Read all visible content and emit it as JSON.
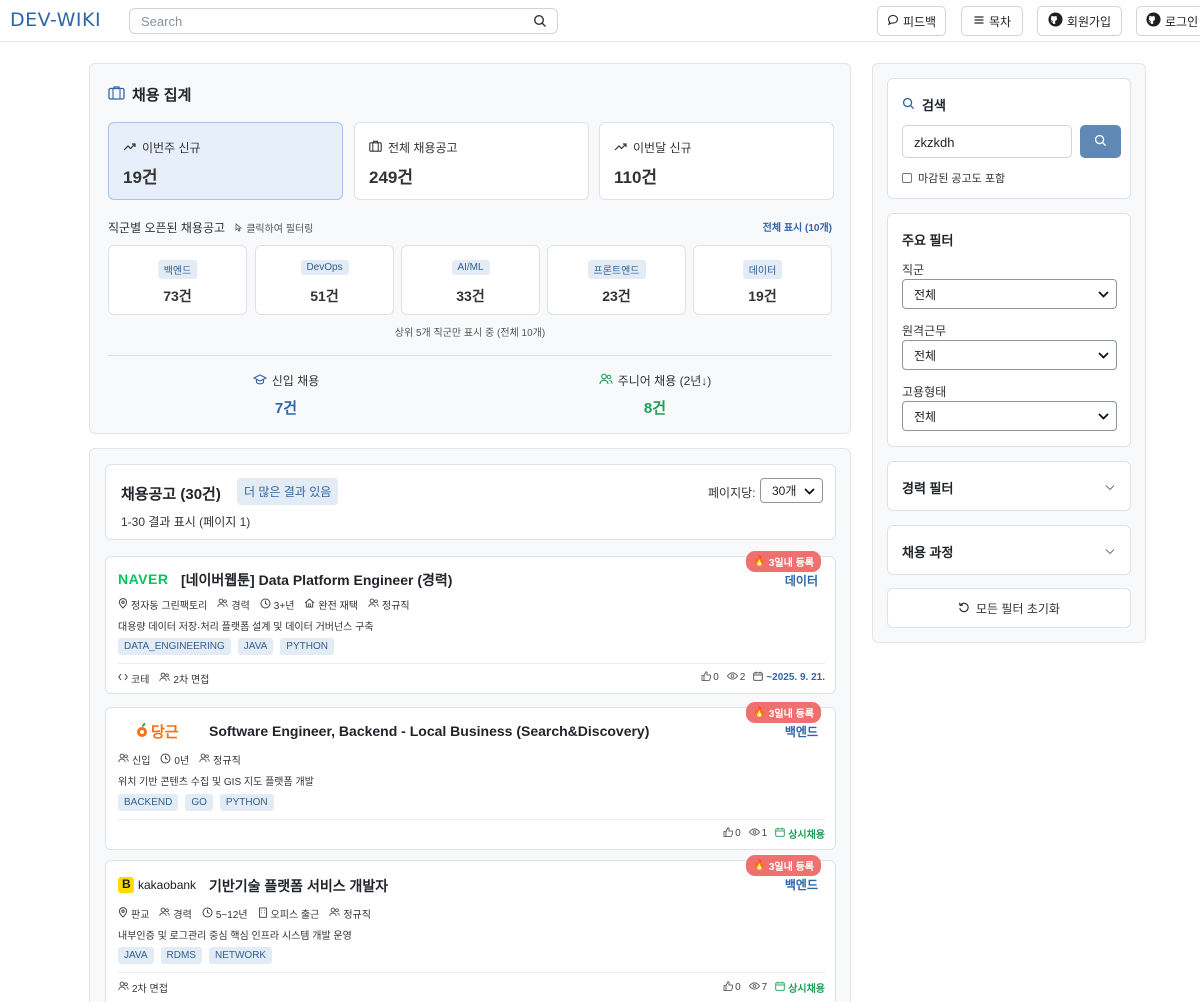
{
  "header": {
    "logo": "DEV-WIKI",
    "search_placeholder": "Search",
    "feedback": "피드백",
    "toc": "목차",
    "signup": "회원가입",
    "login": "로그인"
  },
  "summary": {
    "title": "채용 집계",
    "stats": [
      {
        "label": "이번주 신규",
        "value": "19건"
      },
      {
        "label": "전체 채용공고",
        "value": "249건"
      },
      {
        "label": "이번달 신규",
        "value": "110건"
      }
    ],
    "jobs_section_label": "직군별 오픈된 채용공고",
    "jobs_section_hint": "클릭하여 필터링",
    "show_all": "전체 표시 (10개)",
    "job_groups": [
      {
        "name": "백엔드",
        "count": "73건"
      },
      {
        "name": "DevOps",
        "count": "51건"
      },
      {
        "name": "AI/ML",
        "count": "33건"
      },
      {
        "name": "프론트엔드",
        "count": "23건"
      },
      {
        "name": "데이터",
        "count": "19건"
      }
    ],
    "top_note": "상위 5개 직군만 표시 중 (전체 10개)",
    "newbie": {
      "label": "신입 채용",
      "value": "7건"
    },
    "junior": {
      "label": "주니어 채용 (2년↓)",
      "value": "8건"
    }
  },
  "listing": {
    "title": "채용공고 (30건)",
    "more_badge": "더 많은 결과 있음",
    "per_page_label": "페이지당:",
    "per_page_value": "30개",
    "range_text": "1-30 결과 표시 (페이지 1)",
    "jobs": [
      {
        "company": "NAVER",
        "title": "[네이버웹툰] Data Platform Engineer (경력)",
        "hot": "3일내 등록",
        "category": "데이터",
        "meta": {
          "location": "정자동 그린팩토리",
          "level": "경력",
          "years": "3+년",
          "remote": "완전 재택",
          "employment": "정규직"
        },
        "desc": "대용량 데이터 저장·처리 플랫폼 설계 및 데이터 거버넌스 구축",
        "tags": [
          "DATA_ENGINEERING",
          "JAVA",
          "PYTHON"
        ],
        "footer": {
          "coding": "코테",
          "interview": "2차 면접"
        },
        "likes": "0",
        "views": "2",
        "deadline": "~2025. 9. 21."
      },
      {
        "company": "당근",
        "title": "Software Engineer, Backend - Local Business (Search&Discovery)",
        "hot": "3일내 등록",
        "category": "백엔드",
        "meta": {
          "level": "신입",
          "years": "0년",
          "employment": "정규직"
        },
        "desc": "위치 기반 콘텐츠 수집 및 GIS 지도 플랫폼 개발",
        "tags": [
          "BACKEND",
          "GO",
          "PYTHON"
        ],
        "likes": "0",
        "views": "1",
        "deadline": "상시채용"
      },
      {
        "company": "kakaobank",
        "title": "기반기술 플랫폼 서비스 개발자",
        "hot": "3일내 등록",
        "category": "백엔드",
        "meta": {
          "location": "판교",
          "level": "경력",
          "years": "5~12년",
          "office": "오피스 출근",
          "employment": "정규직"
        },
        "desc": "내부인증 및 로그관리 중심 핵심 인프라 시스템 개발 운영",
        "tags": [
          "JAVA",
          "RDMS",
          "NETWORK"
        ],
        "footer": {
          "interview": "2차 면접"
        },
        "likes": "0",
        "views": "7",
        "deadline": "상시채용"
      }
    ]
  },
  "sidebar": {
    "search_title": "검색",
    "search_value": "zkzkdh",
    "include_closed": "마감된 공고도 포함",
    "main_filter_title": "주요 필터",
    "filters": [
      {
        "label": "직군",
        "value": "전체"
      },
      {
        "label": "원격근무",
        "value": "전체"
      },
      {
        "label": "고용형태",
        "value": "전체"
      }
    ],
    "career_filter": "경력 필터",
    "process_filter": "채용 과정",
    "reset": "모든 필터 초기화"
  },
  "colors": {
    "accent": "#2f66a8",
    "green": "#1f9d57",
    "hot": "#f07070",
    "search_button": "#5f88b5"
  }
}
